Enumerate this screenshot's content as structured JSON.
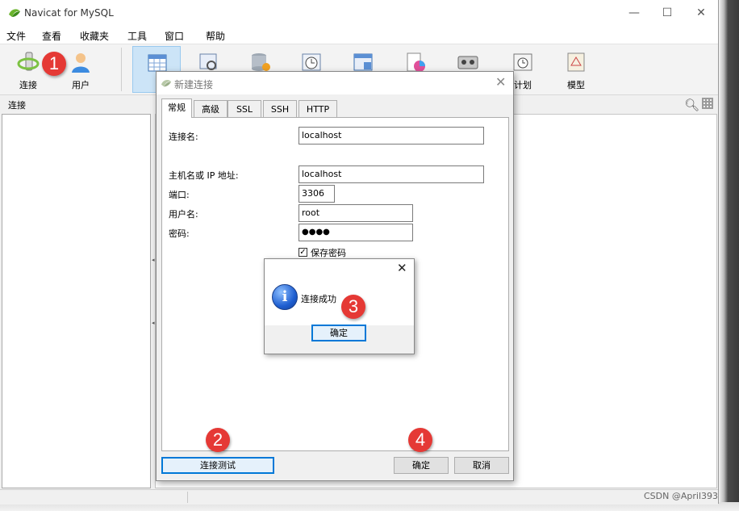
{
  "app": {
    "title": "Navicat for MySQL"
  },
  "window_controls": {
    "minimize": "—",
    "maximize": "☐",
    "close": "✕"
  },
  "menu": [
    "文件",
    "查看",
    "收藏夹",
    "工具",
    "窗口",
    "帮助"
  ],
  "toolbar": {
    "connect_label": "连接",
    "user_label": "用户",
    "schedule_label": "计划",
    "model_label": "模型"
  },
  "sidebar": {
    "header": "连接"
  },
  "dialog": {
    "title": "新建连接",
    "tabs": [
      "常规",
      "高级",
      "SSL",
      "SSH",
      "HTTP"
    ],
    "fields": {
      "connection_name": {
        "label": "连接名:",
        "value": "localhost"
      },
      "host": {
        "label": "主机名或 IP 地址:",
        "value": "localhost"
      },
      "port": {
        "label": "端口:",
        "value": "3306"
      },
      "username": {
        "label": "用户名:",
        "value": "root"
      },
      "password": {
        "label": "密码:",
        "value": "●●●●"
      }
    },
    "save_password": {
      "label": "保存密码",
      "checked": true,
      "mark": "✓"
    },
    "test_button": "连接测试",
    "ok_button": "确定",
    "cancel_button": "取消"
  },
  "message_box": {
    "text": "连接成功",
    "ok_button": "确定",
    "close": "✕",
    "icon": "i"
  },
  "annotations": [
    "1",
    "2",
    "3",
    "4"
  ],
  "watermark": "CSDN @April393",
  "colors": {
    "accent": "#0078d7",
    "badge": "#e53935"
  }
}
